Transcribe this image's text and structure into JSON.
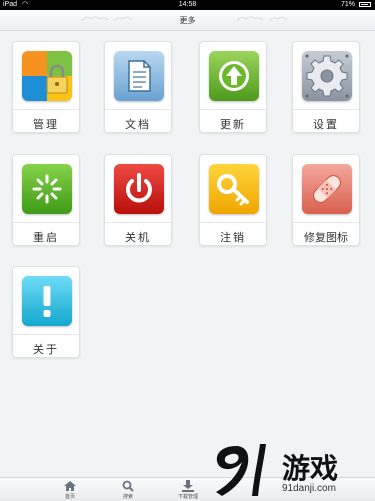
{
  "status_bar": {
    "carrier": "iPad",
    "time": "14:58",
    "battery": "71%"
  },
  "header": {
    "title": "更多"
  },
  "tiles": [
    {
      "label": "管理",
      "icon": "manage-icon"
    },
    {
      "label": "文档",
      "icon": "document-icon"
    },
    {
      "label": "更新",
      "icon": "update-icon"
    },
    {
      "label": "设置",
      "icon": "settings-icon"
    },
    {
      "label": "重启",
      "icon": "restart-icon"
    },
    {
      "label": "关机",
      "icon": "power-icon"
    },
    {
      "label": "注销",
      "icon": "key-icon"
    },
    {
      "label": "修复图标",
      "icon": "repair-icon"
    },
    {
      "label": "关于",
      "icon": "about-icon"
    }
  ],
  "tab_bar": {
    "tabs": [
      {
        "label": "首页",
        "icon": "home-icon"
      },
      {
        "label": "搜索",
        "icon": "search-icon"
      },
      {
        "label": "下载管理",
        "icon": "download-icon"
      }
    ]
  },
  "watermark": {
    "logo_text": "9l",
    "text": "游戏",
    "url": "91danji.com"
  },
  "colors": {
    "header_bg": "#eceef2",
    "restart_green": "#5cb82a",
    "power_red": "#d9201c",
    "key_yellow": "#f5b800",
    "repair_red": "#e77c6e",
    "about_cyan": "#2cbfe2",
    "update_green": "#6bb92a",
    "document_blue": "#7fb2dc",
    "settings_gray": "#9aa4b0"
  }
}
